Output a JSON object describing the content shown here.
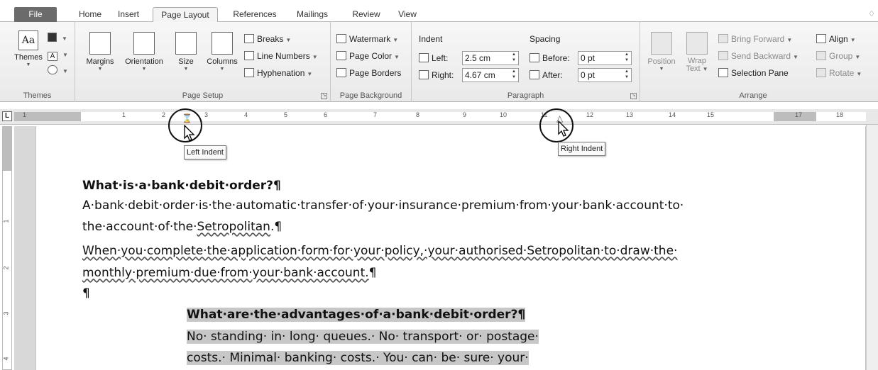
{
  "tabs": [
    {
      "label": "File"
    },
    {
      "label": "Home"
    },
    {
      "label": "Insert"
    },
    {
      "label": "Page Layout"
    },
    {
      "label": "References"
    },
    {
      "label": "Mailings"
    },
    {
      "label": "Review"
    },
    {
      "label": "View"
    }
  ],
  "themes_group": {
    "themes_label": "Themes",
    "group_label": "Themes"
  },
  "page_setup": {
    "margins": "Margins",
    "orientation": "Orientation",
    "size": "Size",
    "columns": "Columns",
    "breaks": "Breaks",
    "line_numbers": "Line Numbers",
    "hyphenation": "Hyphenation",
    "group_label": "Page Setup"
  },
  "page_background": {
    "watermark": "Watermark",
    "page_color": "Page Color",
    "page_borders": "Page Borders",
    "group_label": "Page Background"
  },
  "paragraph": {
    "indent_label": "Indent",
    "left_label": "Left:",
    "left_value": "2.5 cm",
    "right_label": "Right:",
    "right_value": "4.67 cm",
    "spacing_label": "Spacing",
    "before_label": "Before:",
    "before_value": "0 pt",
    "after_label": "After:",
    "after_value": "0 pt",
    "group_label": "Paragraph"
  },
  "arrange": {
    "position": "Position",
    "wrap_text_1": "Wrap",
    "wrap_text_2": "Text",
    "bring_forward": "Bring Forward",
    "send_backward": "Send Backward",
    "selection_pane": "Selection Pane",
    "align": "Align",
    "group": "Group",
    "rotate": "Rotate",
    "group_label": "Arrange"
  },
  "ruler": {
    "corner": "L",
    "h_numbers": [
      "1",
      "1",
      "2",
      "3",
      "4",
      "5",
      "6",
      "7",
      "8",
      "9",
      "10",
      "11",
      "12",
      "13",
      "14",
      "15",
      "17",
      "18"
    ],
    "v_numbers": [
      "1",
      "2",
      "3",
      "4"
    ]
  },
  "tooltips": {
    "left_indent": "Left Indent",
    "right_indent": "Right Indent"
  },
  "document": {
    "heading1": "What·is·a·bank·debit·order?¶",
    "p1_line1": "A·bank·debit·order·is·the·automatic·transfer·of·your·insurance·premium·from·your·bank·account·to·",
    "p1_line2_a": "the·account·of·the·",
    "p1_line2_b": "Setropolitan",
    "p1_line2_c": ".¶",
    "p2_line1": "When·you·complete·the·application·form·for·your·policy,·your·authorised·Setropolitan·to·draw·the·",
    "p2_line2_a": "monthly·premium·due·from·your·bank·account.",
    "p2_line2_b": "¶",
    "empty_para": "¶",
    "heading2": "What·are·the·advantages·of·a·bank·debit·order?¶",
    "p3_line1": "No· standing· in· long· queues.· No· transport· or· postage·",
    "p3_line2": "costs.· Minimal· banking· costs.· You· can· be· sure· your·"
  }
}
